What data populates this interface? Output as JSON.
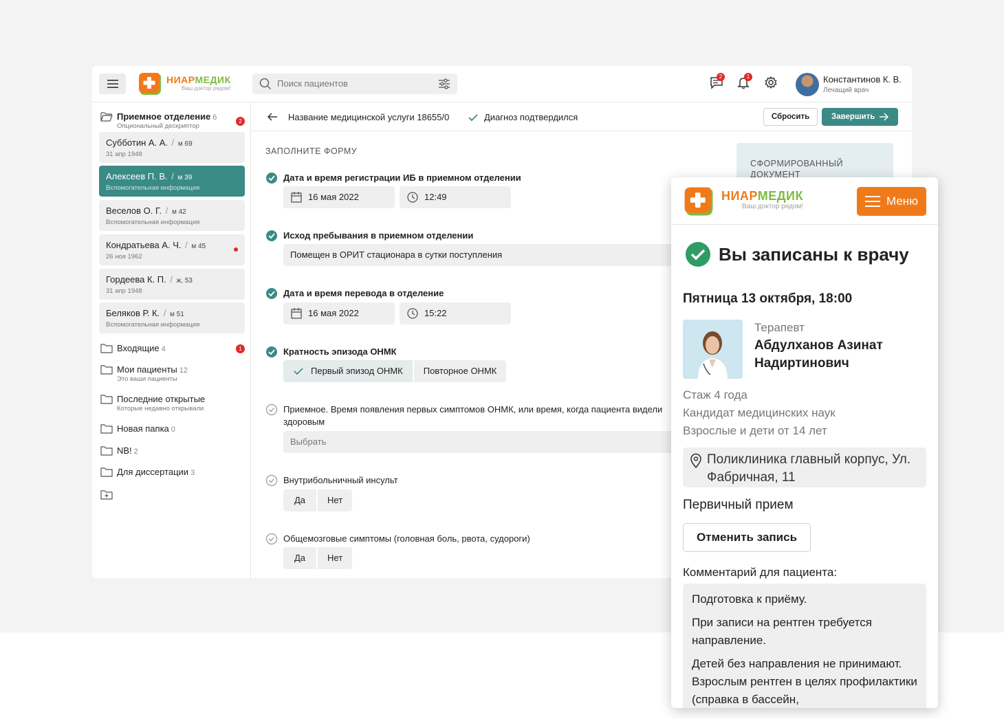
{
  "brand": {
    "name_part1": "НИАР",
    "name_part2": "МЕДИК",
    "tagline": "Ваш доктор рядом!"
  },
  "topbar": {
    "search_placeholder": "Поиск пациентов",
    "messages_badge": "2",
    "notifications_badge": "1",
    "user_name": "Константинов К. В.",
    "user_role": "Лечащий врач"
  },
  "sidebar": {
    "reception": {
      "title": "Приемное отделение",
      "count": "6",
      "subtitle": "Опциональный дескриптор",
      "badge": "2"
    },
    "patients": [
      {
        "name": "Субботин А. А.",
        "meta": "м 69",
        "info": "31 апр 1948"
      },
      {
        "name": "Алексеев П. В.",
        "meta": "м 39",
        "info": "Вспомогательная информация"
      },
      {
        "name": "Веселов О. Г.",
        "meta": "м 42",
        "info": "Вспомогательная информация"
      },
      {
        "name": "Кондратьева А. Ч.",
        "meta": "м 45",
        "info": "26 ноя 1962"
      },
      {
        "name": "Гордеева К. П.",
        "meta": "ж, 53",
        "info": "31 апр 1948"
      },
      {
        "name": "Беляков Р. К.",
        "meta": "м 51",
        "info": "Вспомогательная информация"
      }
    ],
    "folders": [
      {
        "title": "Входящие",
        "count": "4",
        "subtitle": "",
        "badge": "1"
      },
      {
        "title": "Мои пациенты",
        "count": "12",
        "subtitle": "Это ваши пациенты"
      },
      {
        "title": "Последние открытые",
        "count": "",
        "subtitle": "Которые недавно открывали"
      },
      {
        "title": "Новая папка",
        "count": "0",
        "subtitle": ""
      },
      {
        "title": "NB!",
        "count": "2",
        "subtitle": ""
      },
      {
        "title": "Для диссертации",
        "count": "3",
        "subtitle": ""
      }
    ]
  },
  "header": {
    "service_name": "Название медицинской услуги 18655/0",
    "diagnosis_status": "Диагноз подтвердился",
    "reset_label": "Сбросить",
    "finish_label": "Завершить"
  },
  "form": {
    "heading": "ЗАПОЛНИТЕ ФОРМУ",
    "doc_panel": "СФОРМИРОВАННЫЙ ДОКУМЕНТ",
    "q1": {
      "label": "Дата и время регистрации ИБ в приемном отделении",
      "date": "16 мая 2022",
      "time": "12:49"
    },
    "q2": {
      "label": "Исход пребывания в приемном отделении",
      "value": "Помещен в ОРИТ стационара в сутки поступления"
    },
    "q3": {
      "label": "Дата и время перевода в отделение",
      "date": "16 мая 2022",
      "time": "15:22"
    },
    "q4": {
      "label": "Кратность эпизода ОНМК",
      "opt1": "Первый эпизод ОНМК",
      "opt2": "Повторное ОНМК"
    },
    "q5": {
      "label": "Приемное. Время появления первых симптомов ОНМК, или время, когда пациента видели здоровым",
      "placeholder": "Выбрать"
    },
    "q6": {
      "label": "Внутрибольничный инсульт",
      "yes": "Да",
      "no": "Нет"
    },
    "q7": {
      "label": "Общемозговые симптомы (головная боль, рвота, судороги)",
      "yes": "Да",
      "no": "Нет"
    }
  },
  "mobile": {
    "menu_label": "Меню",
    "title": "Вы записаны к врачу",
    "datetime": "Пятница 13 октября, 18:00",
    "specialty": "Терапевт",
    "doctor_name": "Абдулханов Азинат Надиртинович",
    "experience": "Стаж 4 года",
    "degree": "Кандидат медицинских наук",
    "ages": "Взрослые и дети от 14 лет",
    "address": "Поликлиника главный корпус, Ул. Фабричная, 11",
    "visit_type": "Первичный прием",
    "cancel_label": "Отменить запись",
    "comment_label": "Комментарий для пациента:",
    "comment_p1": "Подготовка к приёму.",
    "comment_p2": "При записи на рентген требуется направление.",
    "comment_p3": "Детей без направления не принимают. Взрослым рентген в целях профилактики (справка в бассейн,"
  },
  "colors": {
    "teal": "#3a8a85",
    "orange": "#f07a1a",
    "green": "#7dbb42",
    "red": "#e12a2a"
  }
}
